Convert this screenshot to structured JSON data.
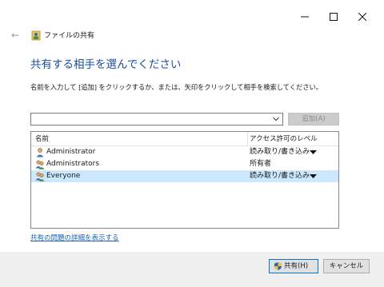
{
  "window": {
    "title": "ファイルの共有",
    "icons": {
      "back": "back-arrow-icon",
      "minimize": "minimize-icon",
      "maximize": "maximize-icon",
      "close": "close-icon"
    }
  },
  "heading": "共有する相手を選んでください",
  "instruction": "名前を入力して [追加] をクリックするか、または、矢印をクリックして相手を検索してください。",
  "combo": {
    "value": "",
    "icon": "chevron-down-icon"
  },
  "add_button": {
    "label": "追加(A)",
    "enabled": false
  },
  "list": {
    "columns": [
      "名前",
      "アクセス許可のレベル"
    ],
    "rows": [
      {
        "name": "Administrator",
        "permission": "読み取り/書き込み",
        "dropdown": true,
        "icon": "user-icon",
        "selected": false
      },
      {
        "name": "Administrators",
        "permission": "所有者",
        "dropdown": false,
        "icon": "group-icon",
        "selected": false
      },
      {
        "name": "Everyone",
        "permission": "読み取り/書き込み",
        "dropdown": true,
        "icon": "group-icon",
        "selected": true
      }
    ]
  },
  "problems_link": "共有の問題の詳細を表示する",
  "buttons": {
    "share": "共有(H)",
    "cancel": "キャンセル",
    "share_icon": "uac-shield-icon"
  },
  "colors": {
    "heading": "#1e4ea0",
    "link": "#1a5fb4",
    "selection": "#cce8ff",
    "footer": "#f0f0f0"
  }
}
